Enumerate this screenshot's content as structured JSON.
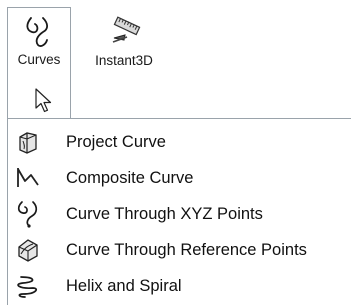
{
  "toolbar": {
    "curves": {
      "label": "Curves",
      "icon": "curves-icon"
    },
    "instant3d": {
      "label": "Instant3D",
      "icon": "instant3d-icon"
    }
  },
  "menu": {
    "items": [
      {
        "label": "Project Curve",
        "icon": "project-curve-icon"
      },
      {
        "label": "Composite Curve",
        "icon": "composite-curve-icon"
      },
      {
        "label": "Curve Through XYZ Points",
        "icon": "curve-xyz-points-icon"
      },
      {
        "label": "Curve Through Reference Points",
        "icon": "curve-reference-points-icon"
      },
      {
        "label": "Helix and Spiral",
        "icon": "helix-spiral-icon"
      }
    ]
  }
}
